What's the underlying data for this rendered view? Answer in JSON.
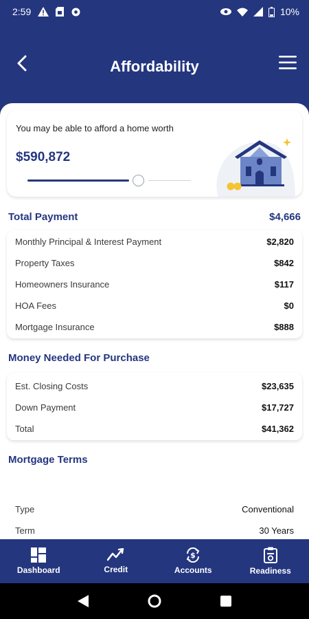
{
  "status_bar": {
    "time": "2:59",
    "battery": "10%",
    "icons_left": [
      "warning-icon",
      "sim-card-icon",
      "settings-gear-icon"
    ],
    "icons_right": [
      "eye-icon",
      "wifi-icon",
      "signal-icon",
      "battery-icon"
    ]
  },
  "header": {
    "title": "Affordability",
    "back_icon": "chevron-left-icon",
    "menu_icon": "hamburger-menu-icon"
  },
  "afford_card": {
    "caption": "You may be able to afford a home worth",
    "value": "$590,872",
    "slider_level": 0.7
  },
  "total_payment": {
    "title": "Total Payment",
    "total": "$4,666",
    "rows": [
      {
        "label": "Monthly Principal & Interest Payment",
        "amount": "$2,820"
      },
      {
        "label": "Property Taxes",
        "amount": "$842"
      },
      {
        "label": "Homeowners Insurance",
        "amount": "$117"
      },
      {
        "label": "HOA Fees",
        "amount": "$0"
      },
      {
        "label": "Mortgage Insurance",
        "amount": "$888"
      }
    ]
  },
  "money_needed": {
    "title": "Money Needed For Purchase",
    "rows": [
      {
        "label": "Est. Closing Costs",
        "amount": "$23,635"
      },
      {
        "label": "Down Payment",
        "amount": "$17,727"
      },
      {
        "label": "Total",
        "amount": "$41,362"
      }
    ]
  },
  "mortgage_terms": {
    "title": "Mortgage Terms",
    "rows": [
      {
        "label": "Type",
        "amount": "Conventional"
      },
      {
        "label": "Term",
        "amount": "30 Years"
      }
    ]
  },
  "bottom_nav": [
    {
      "label": "Dashboard",
      "icon": "dashboard-grid-icon"
    },
    {
      "label": "Credit",
      "icon": "credit-trend-icon"
    },
    {
      "label": "Accounts",
      "icon": "accounts-dollar-icon"
    },
    {
      "label": "Readiness",
      "icon": "readiness-clipboard-icon"
    }
  ],
  "colors": {
    "brand": "#24367e",
    "background": "#ffffff",
    "text": "#3a3a3a"
  }
}
